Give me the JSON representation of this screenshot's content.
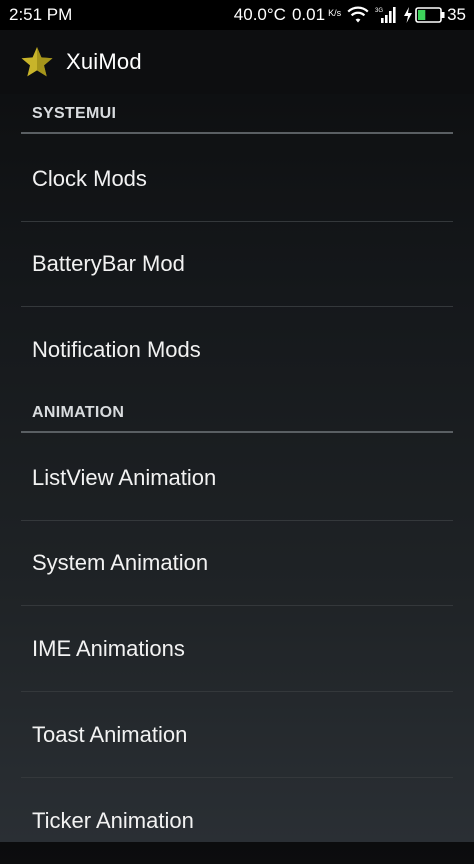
{
  "status_bar": {
    "time": "2:51 PM",
    "temperature": "40.0°C",
    "speed": "0.01",
    "speed_unit": "K/s",
    "battery_level": "35"
  },
  "app_bar": {
    "title": "XuiMod"
  },
  "sections": [
    {
      "header": "SYSTEMUI",
      "items": [
        "Clock Mods",
        "BatteryBar Mod",
        "Notification Mods"
      ]
    },
    {
      "header": "ANIMATION",
      "items": [
        "ListView Animation",
        "System Animation",
        "IME Animations",
        "Toast Animation",
        "Ticker Animation"
      ]
    }
  ],
  "colors": {
    "star_icon": "#c8b42a",
    "battery_fill": "#3ed35b"
  }
}
